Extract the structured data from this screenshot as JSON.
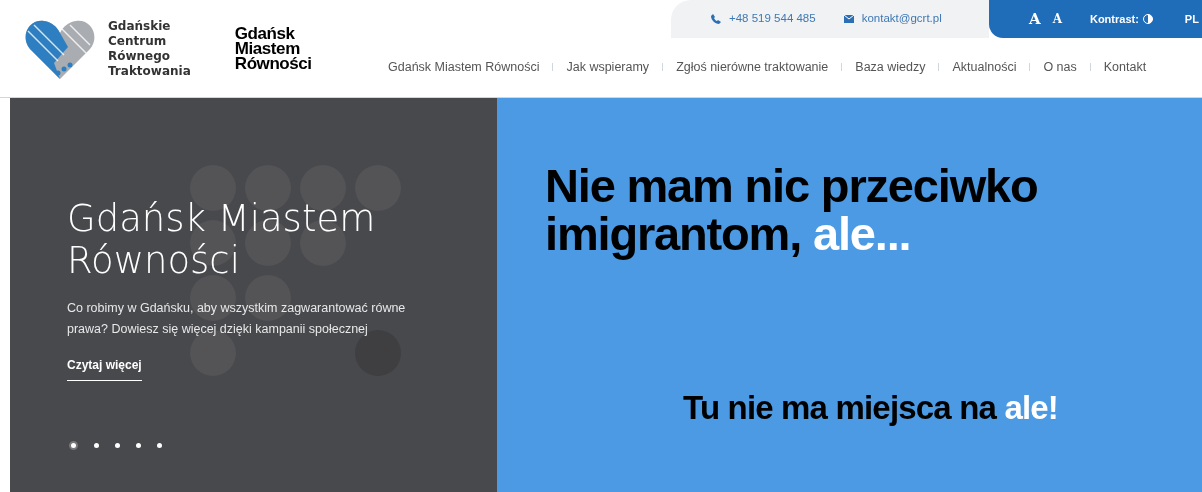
{
  "logo": {
    "lines": [
      "Gdańskie",
      "Centrum",
      "Równego",
      "Traktowania"
    ]
  },
  "campaign_logo": {
    "lines": [
      "Gdańsk",
      "Miastem",
      "Równości"
    ]
  },
  "contact": {
    "phone": "+48 519 544 485",
    "email": "kontakt@gcrt.pl"
  },
  "accessibility": {
    "font_sizes": [
      "A",
      "A"
    ],
    "contrast_label": "Kontrast:",
    "language": "PL"
  },
  "nav": [
    {
      "label": "Gdańsk Miastem Równości"
    },
    {
      "label": "Jak wspieramy"
    },
    {
      "label": "Zgłoś nierówne traktowanie"
    },
    {
      "label": "Baza wiedzy"
    },
    {
      "label": "Aktualności"
    },
    {
      "label": "O nas"
    },
    {
      "label": "Kontakt"
    }
  ],
  "hero": {
    "title": "Gdańsk Miastem Równości",
    "text": "Co robimy w Gdańsku, aby wszystkim zagwarantować równe prawa? Dowiesz się więcej dzięki kampanii społecznej",
    "link": "Czytaj więcej",
    "dots": [
      {
        "selected": true
      },
      {
        "selected": false
      },
      {
        "selected": false
      },
      {
        "selected": false
      },
      {
        "selected": false
      }
    ]
  },
  "banner": {
    "headline": "Nie mam nic przeciwko imigrantom, **ale...**",
    "tagline": "Tu nie ma miejsca na **ale!**"
  }
}
